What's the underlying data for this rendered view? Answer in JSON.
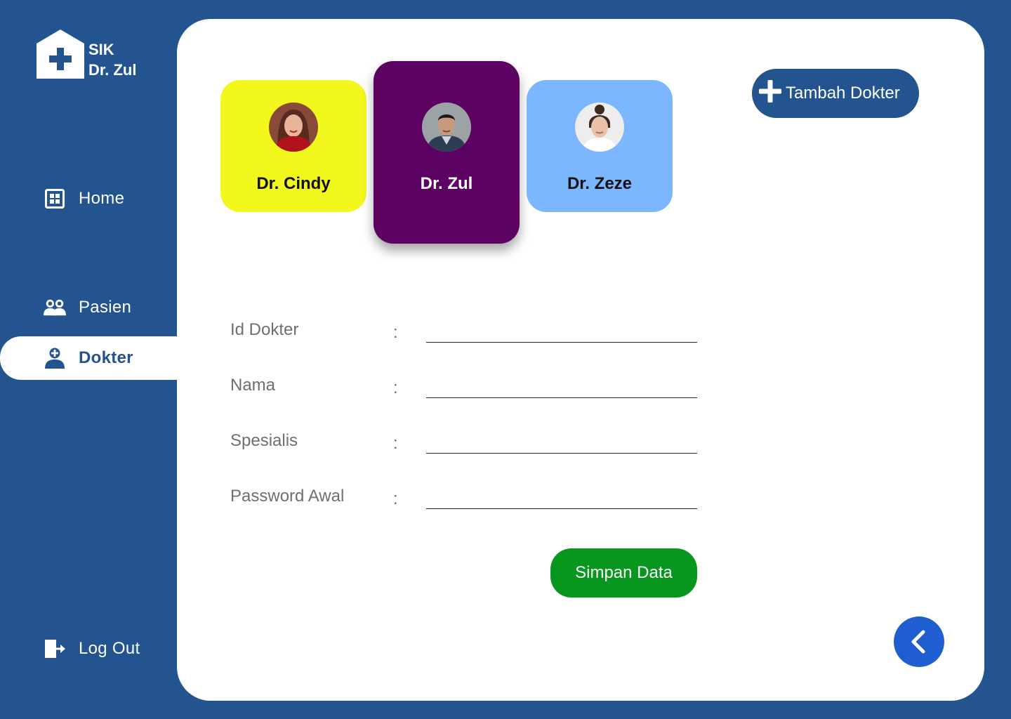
{
  "brand": {
    "line1": "SIK",
    "line2": "Dr. Zul"
  },
  "sidebar": {
    "items": [
      {
        "label": "Home",
        "icon": "grid-icon"
      },
      {
        "label": "Pasien",
        "icon": "users-icon"
      },
      {
        "label": "Dokter",
        "icon": "doctor-icon",
        "active": true
      },
      {
        "label": "Log Out",
        "icon": "logout-icon"
      }
    ]
  },
  "doctors": [
    {
      "name": "Dr. Cindy",
      "color": "#f2f71c"
    },
    {
      "name": "Dr. Zul",
      "color": "#5b0262",
      "selected": true
    },
    {
      "name": "Dr. Zeze",
      "color": "#7bb6ff"
    }
  ],
  "toolbar": {
    "add_label": "Tambah Dokter"
  },
  "form": {
    "fields": [
      {
        "label": "Id Dokter",
        "sep": ":",
        "value": ""
      },
      {
        "label": "Nama",
        "sep": ":",
        "value": ""
      },
      {
        "label": "Spesialis",
        "sep": ":",
        "value": ""
      },
      {
        "label": "Password Awal",
        "sep": ":",
        "value": ""
      }
    ],
    "submit_label": "Simpan Data"
  },
  "colors": {
    "background": "#23548f",
    "save": "#08961e",
    "back": "#1f5ed0"
  }
}
